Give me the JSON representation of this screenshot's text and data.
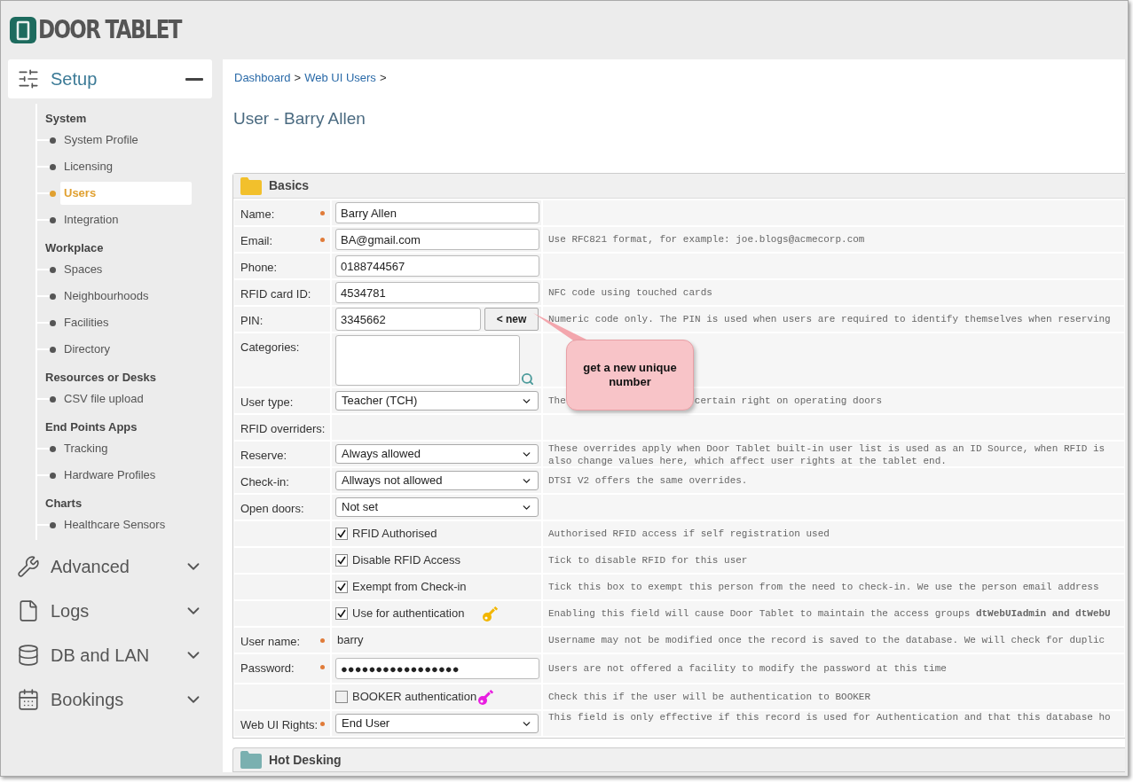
{
  "logo": {
    "text": "DOOR TABLET"
  },
  "sidebar": {
    "sections": [
      {
        "label": "Setup",
        "expanded": true,
        "groups": [
          {
            "title": "System",
            "items": [
              {
                "label": "System Profile",
                "selected": false
              },
              {
                "label": "Licensing",
                "selected": false
              },
              {
                "label": "Users",
                "selected": true
              },
              {
                "label": "Integration",
                "selected": false
              }
            ]
          },
          {
            "title": "Workplace",
            "items": [
              {
                "label": "Spaces",
                "selected": false
              },
              {
                "label": "Neighbourhoods",
                "selected": false
              },
              {
                "label": "Facilities",
                "selected": false
              },
              {
                "label": "Directory",
                "selected": false
              }
            ]
          },
          {
            "title": "Resources or Desks",
            "items": [
              {
                "label": "CSV file upload",
                "selected": false
              }
            ]
          },
          {
            "title": "End Points Apps",
            "items": [
              {
                "label": "Tracking",
                "selected": false
              },
              {
                "label": "Hardware Profiles",
                "selected": false
              }
            ]
          },
          {
            "title": "Charts",
            "items": [
              {
                "label": "Healthcare Sensors",
                "selected": false
              }
            ]
          }
        ]
      },
      {
        "label": "Advanced",
        "expanded": false
      },
      {
        "label": "Logs",
        "expanded": false
      },
      {
        "label": "DB and LAN",
        "expanded": false
      },
      {
        "label": "Bookings",
        "expanded": false
      }
    ]
  },
  "breadcrumb": [
    "Dashboard",
    ">",
    "Web UI Users",
    ">"
  ],
  "title": "User - Barry Allen",
  "basics": {
    "title": "Basics",
    "rows": [
      {
        "kind": "input",
        "label": "Name:",
        "required": true,
        "value": "Barry Allen"
      },
      {
        "kind": "input",
        "label": "Email:",
        "required": true,
        "value": "BA@gmail.com",
        "hint": "Use RFC821 format, for example: joe.blogs@acmecorp.com"
      },
      {
        "kind": "input",
        "label": "Phone:",
        "required": false,
        "value": "0188744567"
      },
      {
        "kind": "input",
        "label": "RFID card ID:",
        "required": false,
        "value": "4534781",
        "hint": "NFC code using touched cards"
      },
      {
        "kind": "pin",
        "label": "PIN:",
        "required": false,
        "value": "3345662",
        "button": "< new",
        "hint": "Numeric code only. The PIN is used when users are required to identify themselves when reserving"
      },
      {
        "kind": "textarea",
        "label": "Categories:",
        "required": false
      },
      {
        "kind": "select",
        "label": "User type:",
        "required": false,
        "value": "Teacher (TCH)",
        "hint_parts": [
          "The",
          "certain right on operating doors"
        ]
      },
      {
        "kind": "heading",
        "label": "RFID overriders:",
        "required": false
      },
      {
        "kind": "select",
        "label": "Reserve:",
        "required": false,
        "value": "Always allowed",
        "hint": "These overrides apply when Door Tablet built-in user list is used as an ID Source, when RFID is\nalso change values here, which affect user rights at the tablet end."
      },
      {
        "kind": "select",
        "label": "Check-in:",
        "required": false,
        "value": "Allways not allowed",
        "hint": "DTSI V2 offers the same overrides."
      },
      {
        "kind": "select",
        "label": "Open doors:",
        "required": false,
        "value": "Not set"
      },
      {
        "kind": "checkbox",
        "text": "RFID Authorised",
        "checked": true,
        "hint": "Authorised RFID access if self registration used"
      },
      {
        "kind": "checkbox",
        "text": "Disable RFID Access",
        "checked": true,
        "hint": "Tick to disable RFID for this user"
      },
      {
        "kind": "checkbox",
        "text": "Exempt from Check-in",
        "checked": true,
        "hint": "Tick this box to exempt this person from the need to check-in.  We use the person email address"
      },
      {
        "kind": "checkbox",
        "text": "Use for authentication",
        "checked": true,
        "color": "#f2b600",
        "hint": "Enabling this field will cause Door Tablet to maintain the access groups **dtWebUIadmin and dtWebU**"
      },
      {
        "kind": "static",
        "label": "User name:",
        "required": true,
        "value": "barry",
        "hint": "Username may not be modified once the record is saved to the database.  We will check for duplic"
      },
      {
        "kind": "input",
        "label": "Password:",
        "required": true,
        "value": "●●●●●●●●●●●●●●●●●",
        "hint": "Users are not offered a facility to modify the password at this time"
      },
      {
        "kind": "checkbox",
        "text": "BOOKER authentication",
        "checked": false,
        "color": "#e81ee0",
        "hint": "Check this if the user will be authentication to BOOKER"
      },
      {
        "kind": "select",
        "label": "Web UI Rights:",
        "required": true,
        "value": "End User",
        "hint": "This field is only effective if this record is used for Authentication and that this database ho"
      }
    ]
  },
  "hot_desking": {
    "title": "Hot Desking"
  },
  "callout": {
    "text": "get a new unique number"
  }
}
